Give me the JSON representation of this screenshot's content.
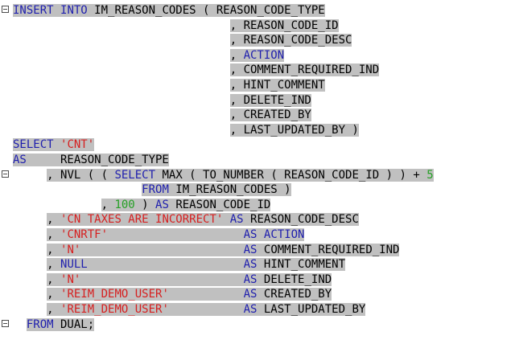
{
  "editor": {
    "lines": [
      {
        "fold": true,
        "tokens": [
          {
            "t": "kw",
            "v": "INSERT"
          },
          {
            "t": "pl",
            "v": " "
          },
          {
            "t": "kw",
            "v": "INTO"
          },
          {
            "t": "pl",
            "v": " IM_REASON_CODES ( REASON_CODE_TYPE"
          }
        ]
      },
      {
        "fold": false,
        "tokens": [
          {
            "t": "pl",
            "v": "                                , REASON_CODE_ID"
          }
        ]
      },
      {
        "fold": false,
        "tokens": [
          {
            "t": "pl",
            "v": "                                , REASON_CODE_DESC"
          }
        ]
      },
      {
        "fold": false,
        "tokens": [
          {
            "t": "pl",
            "v": "                                , "
          },
          {
            "t": "kw",
            "v": "ACTION"
          }
        ]
      },
      {
        "fold": false,
        "tokens": [
          {
            "t": "pl",
            "v": "                                , COMMENT_REQUIRED_IND"
          }
        ]
      },
      {
        "fold": false,
        "tokens": [
          {
            "t": "pl",
            "v": "                                , HINT_COMMENT"
          }
        ]
      },
      {
        "fold": false,
        "tokens": [
          {
            "t": "pl",
            "v": "                                , DELETE_IND"
          }
        ]
      },
      {
        "fold": false,
        "tokens": [
          {
            "t": "pl",
            "v": "                                , CREATED_BY"
          }
        ]
      },
      {
        "fold": false,
        "tokens": [
          {
            "t": "pl",
            "v": "                                , LAST_UPDATED_BY )"
          }
        ]
      },
      {
        "fold": false,
        "tokens": [
          {
            "t": "kw",
            "v": "SELECT"
          },
          {
            "t": "pl",
            "v": " "
          },
          {
            "t": "str",
            "v": "'CNT'"
          }
        ]
      },
      {
        "fold": false,
        "tokens": [
          {
            "t": "kw",
            "v": "AS"
          },
          {
            "t": "pl",
            "v": "     REASON_CODE_TYPE"
          }
        ]
      },
      {
        "fold": true,
        "tokens": [
          {
            "t": "pl",
            "v": "     , NVL ( ( "
          },
          {
            "t": "kw",
            "v": "SELECT"
          },
          {
            "t": "pl",
            "v": " MAX ( TO_NUMBER ( REASON_CODE_ID ) ) + "
          },
          {
            "t": "num",
            "v": "5"
          }
        ]
      },
      {
        "fold": false,
        "tokens": [
          {
            "t": "pl",
            "v": "                   "
          },
          {
            "t": "kw",
            "v": "FROM"
          },
          {
            "t": "pl",
            "v": " IM_REASON_CODES )"
          }
        ]
      },
      {
        "fold": false,
        "tokens": [
          {
            "t": "pl",
            "v": "             , "
          },
          {
            "t": "num",
            "v": "100"
          },
          {
            "t": "pl",
            "v": " ) "
          },
          {
            "t": "kw",
            "v": "AS"
          },
          {
            "t": "pl",
            "v": " REASON_CODE_ID"
          }
        ]
      },
      {
        "fold": false,
        "tokens": [
          {
            "t": "pl",
            "v": "     , "
          },
          {
            "t": "str",
            "v": "'CN TAXES ARE INCORRECT'"
          },
          {
            "t": "pl",
            "v": " "
          },
          {
            "t": "kw",
            "v": "AS"
          },
          {
            "t": "pl",
            "v": " REASON_CODE_DESC"
          }
        ]
      },
      {
        "fold": false,
        "tokens": [
          {
            "t": "pl",
            "v": "     , "
          },
          {
            "t": "str",
            "v": "'CNRTF'"
          },
          {
            "t": "pl",
            "v": "                    "
          },
          {
            "t": "kw",
            "v": "AS"
          },
          {
            "t": "pl",
            "v": " "
          },
          {
            "t": "kw",
            "v": "ACTION"
          }
        ]
      },
      {
        "fold": false,
        "tokens": [
          {
            "t": "pl",
            "v": "     , "
          },
          {
            "t": "str",
            "v": "'N'"
          },
          {
            "t": "pl",
            "v": "                        "
          },
          {
            "t": "kw",
            "v": "AS"
          },
          {
            "t": "pl",
            "v": " COMMENT_REQUIRED_IND"
          }
        ]
      },
      {
        "fold": false,
        "tokens": [
          {
            "t": "pl",
            "v": "     , "
          },
          {
            "t": "kw",
            "v": "NULL"
          },
          {
            "t": "pl",
            "v": "                       "
          },
          {
            "t": "kw",
            "v": "AS"
          },
          {
            "t": "pl",
            "v": " HINT_COMMENT"
          }
        ]
      },
      {
        "fold": false,
        "tokens": [
          {
            "t": "pl",
            "v": "     , "
          },
          {
            "t": "str",
            "v": "'N'"
          },
          {
            "t": "pl",
            "v": "                        "
          },
          {
            "t": "kw",
            "v": "AS"
          },
          {
            "t": "pl",
            "v": " DELETE_IND"
          }
        ]
      },
      {
        "fold": false,
        "tokens": [
          {
            "t": "pl",
            "v": "     , "
          },
          {
            "t": "str",
            "v": "'REIM_DEMO_USER'"
          },
          {
            "t": "pl",
            "v": "           "
          },
          {
            "t": "kw",
            "v": "AS"
          },
          {
            "t": "pl",
            "v": " CREATED_BY"
          }
        ]
      },
      {
        "fold": false,
        "tokens": [
          {
            "t": "pl",
            "v": "     , "
          },
          {
            "t": "str",
            "v": "'REIM_DEMO_USER'"
          },
          {
            "t": "pl",
            "v": "           "
          },
          {
            "t": "kw",
            "v": "AS"
          },
          {
            "t": "pl",
            "v": " LAST_UPDATED_BY"
          }
        ]
      },
      {
        "fold": true,
        "tokens": [
          {
            "t": "pl",
            "v": "  "
          },
          {
            "t": "kw",
            "v": "FROM"
          },
          {
            "t": "pl",
            "v": " DUAL;"
          }
        ]
      }
    ]
  },
  "colors": {
    "keyword": "#1f1fae",
    "string": "#d62020",
    "number": "#25a025",
    "selection": "#c0c0c0"
  }
}
